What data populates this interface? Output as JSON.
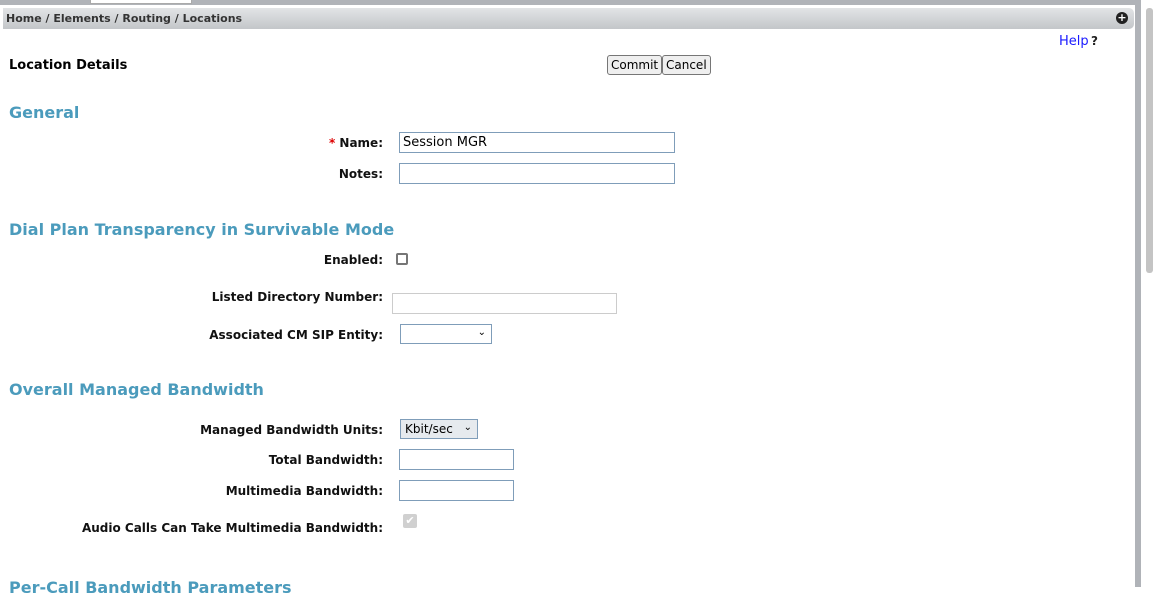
{
  "breadcrumb": "Home / Elements / Routing / Locations",
  "expand_icon": "plus-circle-icon",
  "help": {
    "label": "Help",
    "icon": "?"
  },
  "page_title": "Location Details",
  "buttons": {
    "commit": "Commit",
    "cancel": "Cancel"
  },
  "sections": {
    "general": "General",
    "dial_plan": "Dial Plan Transparency in Survivable Mode",
    "bandwidth": "Overall Managed Bandwidth",
    "per_call": "Per-Call Bandwidth Parameters"
  },
  "fields": {
    "name": {
      "label": "Name:",
      "required": "*",
      "value": "Session MGR"
    },
    "notes": {
      "label": "Notes:",
      "value": ""
    },
    "enabled": {
      "label": "Enabled:",
      "checked": false
    },
    "listed_dn": {
      "label": "Listed Directory Number:",
      "value": ""
    },
    "cm_sip_entity": {
      "label": "Associated CM SIP Entity:",
      "value": ""
    },
    "bw_units": {
      "label": "Managed Bandwidth Units:",
      "value": "Kbit/sec"
    },
    "total_bw": {
      "label": "Total Bandwidth:",
      "value": ""
    },
    "mm_bw": {
      "label": "Multimedia Bandwidth:",
      "value": ""
    },
    "audio_mm": {
      "label": "Audio Calls Can Take Multimedia Bandwidth:",
      "checked": true,
      "disabled": true
    }
  },
  "colors": {
    "section_heading": "#4b9bbc",
    "link": "#1a1aff",
    "required": "#dd0000"
  }
}
